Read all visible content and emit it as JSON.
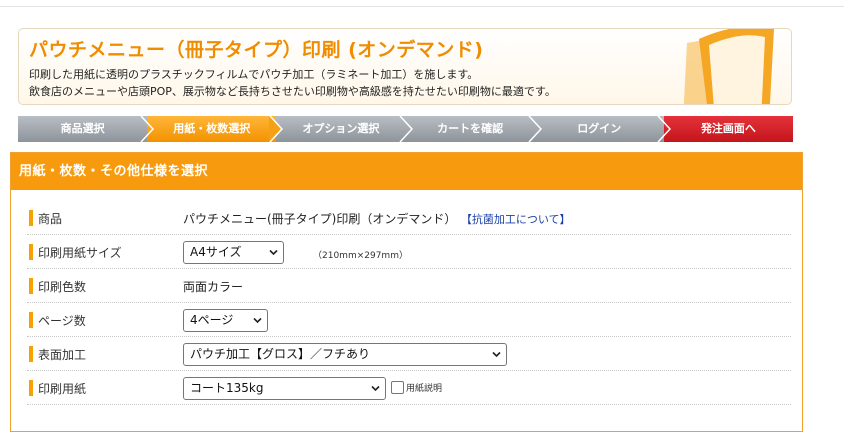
{
  "header": {
    "title": "パウチメニュー（冊子タイプ）印刷 (オンデマンド)",
    "desc1": "印刷した用紙に透明のプラスチックフィルムでパウチ加工（ラミネート加工）を施します。",
    "desc2": "飲食店のメニューや店頭POP、展示物など長持ちさせたい印刷物や高級感を持たせたい印刷物に最適です。"
  },
  "steps": [
    {
      "label": "商品選択"
    },
    {
      "label": "用紙・枚数選択"
    },
    {
      "label": "オプション選択"
    },
    {
      "label": "カートを確認"
    },
    {
      "label": "ログイン"
    },
    {
      "label": "発注画面へ"
    }
  ],
  "section": {
    "title": "用紙・枚数・その他仕様を選択"
  },
  "rows": {
    "product": {
      "label": "商品",
      "value": "パウチメニュー(冊子タイプ)印刷（オンデマンド）",
      "link": "【抗菌加工について】"
    },
    "size": {
      "label": "印刷用紙サイズ",
      "selected": "A4サイズ",
      "hint": "（210mm×297mm）"
    },
    "colors": {
      "label": "印刷色数",
      "value": "両面カラー"
    },
    "pages": {
      "label": "ページ数",
      "selected": "4ページ"
    },
    "finish": {
      "label": "表面加工",
      "selected": "パウチ加工【グロス】／フチあり"
    },
    "paper": {
      "label": "印刷用紙",
      "selected": "コート135kg",
      "check_label": "用紙説明"
    }
  },
  "colors": {
    "accent": "#f79a0d",
    "title_orange": "#f08c00",
    "step_gray": "#a4a9af",
    "step_red": "#d0242c",
    "link_blue": "#1b3fa8"
  }
}
